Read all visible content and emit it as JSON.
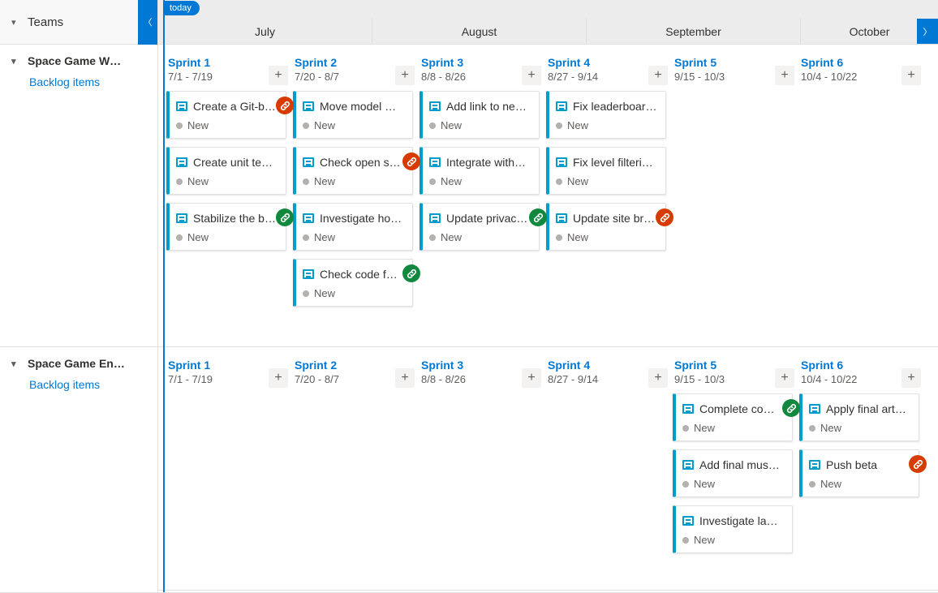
{
  "sidebar": {
    "header": "Teams",
    "teams": [
      {
        "name": "Space Game W…",
        "sub": "Backlog items"
      },
      {
        "name": "Space Game En…",
        "sub": "Backlog items"
      }
    ]
  },
  "timeline": {
    "today_label": "today",
    "months": [
      "July",
      "August",
      "September",
      "October"
    ]
  },
  "status_new": "New",
  "lanes": [
    {
      "sprints": [
        {
          "name": "Sprint 1",
          "dates": "7/1 - 7/19",
          "cards": [
            {
              "title": "Create a Git-b…",
              "badge": "red"
            },
            {
              "title": "Create unit te…"
            },
            {
              "title": "Stabilize the b…",
              "badge": "green"
            }
          ]
        },
        {
          "name": "Sprint 2",
          "dates": "7/20 - 8/7",
          "cards": [
            {
              "title": "Move model …"
            },
            {
              "title": "Check open s…",
              "badge": "red"
            },
            {
              "title": "Investigate ho…"
            },
            {
              "title": "Check code f…",
              "badge": "green"
            }
          ]
        },
        {
          "name": "Sprint 3",
          "dates": "8/8 - 8/26",
          "cards": [
            {
              "title": "Add link to ne…"
            },
            {
              "title": "Integrate with…"
            },
            {
              "title": "Update privac…",
              "badge": "green"
            }
          ]
        },
        {
          "name": "Sprint 4",
          "dates": "8/27 - 9/14",
          "cards": [
            {
              "title": "Fix leaderboar…"
            },
            {
              "title": "Fix level filteri…"
            },
            {
              "title": "Update site br…",
              "badge": "red"
            }
          ]
        },
        {
          "name": "Sprint 5",
          "dates": "9/15 - 10/3",
          "cards": []
        },
        {
          "name": "Sprint 6",
          "dates": "10/4 - 10/22",
          "cards": []
        }
      ]
    },
    {
      "sprints": [
        {
          "name": "Sprint 1",
          "dates": "7/1 - 7/19",
          "cards": []
        },
        {
          "name": "Sprint 2",
          "dates": "7/20 - 8/7",
          "cards": []
        },
        {
          "name": "Sprint 3",
          "dates": "8/8 - 8/26",
          "cards": []
        },
        {
          "name": "Sprint 4",
          "dates": "8/27 - 9/14",
          "cards": []
        },
        {
          "name": "Sprint 5",
          "dates": "9/15 - 10/3",
          "cards": [
            {
              "title": "Complete co…",
              "badge": "green"
            },
            {
              "title": "Add final mus…"
            },
            {
              "title": "Investigate la…"
            }
          ]
        },
        {
          "name": "Sprint 6",
          "dates": "10/4 - 10/22",
          "cards": [
            {
              "title": "Apply final art…"
            },
            {
              "title": "Push beta",
              "badge": "red"
            }
          ]
        }
      ]
    }
  ]
}
